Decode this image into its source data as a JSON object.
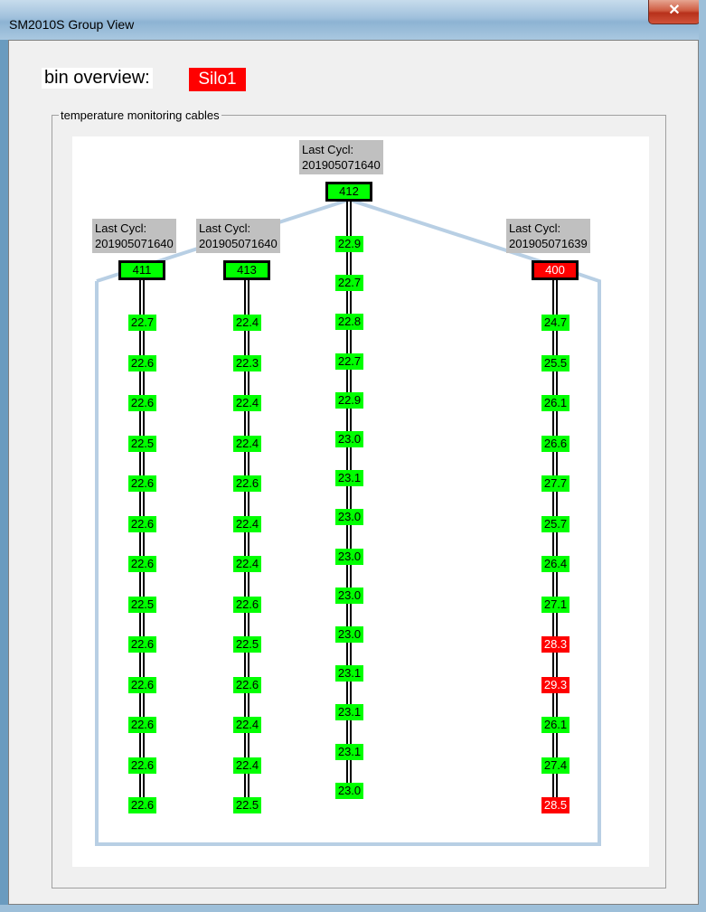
{
  "window": {
    "title": "SM2010S Group View",
    "close_symbol": "✕"
  },
  "bin": {
    "label": "bin overview:",
    "value": "Silo1",
    "value_color": "#ff0000"
  },
  "group": {
    "legend": "temperature monitoring cables"
  },
  "colors": {
    "ok": "#00ff00",
    "alarm": "#ff0000",
    "silo_outline": "#b8cfe4"
  },
  "cables": [
    {
      "id": "411",
      "cycl_label": "Last Cycl:",
      "cycl_value": "201905071640",
      "status": "ok",
      "sensors": [
        {
          "value": "22.7",
          "status": "ok"
        },
        {
          "value": "22.6",
          "status": "ok"
        },
        {
          "value": "22.6",
          "status": "ok"
        },
        {
          "value": "22.5",
          "status": "ok"
        },
        {
          "value": "22.6",
          "status": "ok"
        },
        {
          "value": "22.6",
          "status": "ok"
        },
        {
          "value": "22.6",
          "status": "ok"
        },
        {
          "value": "22.5",
          "status": "ok"
        },
        {
          "value": "22.6",
          "status": "ok"
        },
        {
          "value": "22.6",
          "status": "ok"
        },
        {
          "value": "22.6",
          "status": "ok"
        },
        {
          "value": "22.6",
          "status": "ok"
        },
        {
          "value": "22.6",
          "status": "ok"
        }
      ]
    },
    {
      "id": "413",
      "cycl_label": "Last Cycl:",
      "cycl_value": "201905071640",
      "status": "ok",
      "sensors": [
        {
          "value": "22.4",
          "status": "ok"
        },
        {
          "value": "22.3",
          "status": "ok"
        },
        {
          "value": "22.4",
          "status": "ok"
        },
        {
          "value": "22.4",
          "status": "ok"
        },
        {
          "value": "22.6",
          "status": "ok"
        },
        {
          "value": "22.4",
          "status": "ok"
        },
        {
          "value": "22.4",
          "status": "ok"
        },
        {
          "value": "22.6",
          "status": "ok"
        },
        {
          "value": "22.5",
          "status": "ok"
        },
        {
          "value": "22.6",
          "status": "ok"
        },
        {
          "value": "22.4",
          "status": "ok"
        },
        {
          "value": "22.4",
          "status": "ok"
        },
        {
          "value": "22.5",
          "status": "ok"
        }
      ]
    },
    {
      "id": "412",
      "cycl_label": "Last Cycl:",
      "cycl_value": "201905071640",
      "status": "ok",
      "sensors": [
        {
          "value": "22.9",
          "status": "ok"
        },
        {
          "value": "22.7",
          "status": "ok"
        },
        {
          "value": "22.8",
          "status": "ok"
        },
        {
          "value": "22.7",
          "status": "ok"
        },
        {
          "value": "22.9",
          "status": "ok"
        },
        {
          "value": "23.0",
          "status": "ok"
        },
        {
          "value": "23.1",
          "status": "ok"
        },
        {
          "value": "23.0",
          "status": "ok"
        },
        {
          "value": "23.0",
          "status": "ok"
        },
        {
          "value": "23.0",
          "status": "ok"
        },
        {
          "value": "23.0",
          "status": "ok"
        },
        {
          "value": "23.1",
          "status": "ok"
        },
        {
          "value": "23.1",
          "status": "ok"
        },
        {
          "value": "23.1",
          "status": "ok"
        },
        {
          "value": "23.0",
          "status": "ok"
        }
      ]
    },
    {
      "id": "400",
      "cycl_label": "Last Cycl:",
      "cycl_value": "201905071639",
      "status": "alarm",
      "sensors": [
        {
          "value": "24.7",
          "status": "ok"
        },
        {
          "value": "25.5",
          "status": "ok"
        },
        {
          "value": "26.1",
          "status": "ok"
        },
        {
          "value": "26.6",
          "status": "ok"
        },
        {
          "value": "27.7",
          "status": "ok"
        },
        {
          "value": "25.7",
          "status": "ok"
        },
        {
          "value": "26.4",
          "status": "ok"
        },
        {
          "value": "27.1",
          "status": "ok"
        },
        {
          "value": "28.3",
          "status": "alarm"
        },
        {
          "value": "29.3",
          "status": "alarm"
        },
        {
          "value": "26.1",
          "status": "ok"
        },
        {
          "value": "27.4",
          "status": "ok"
        },
        {
          "value": "28.5",
          "status": "alarm"
        }
      ]
    }
  ]
}
